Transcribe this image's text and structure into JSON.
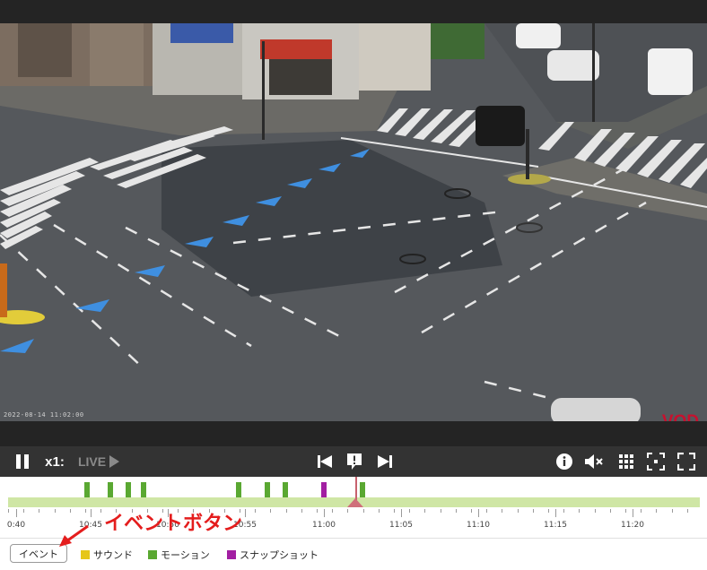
{
  "video": {
    "timestamp": "2022-08-14 11:02:00",
    "badge": "VOD"
  },
  "controls": {
    "speed": "x1:",
    "live": "LIVE",
    "icons": [
      "pause-icon",
      "play-icon",
      "skip-previous-icon",
      "event-mark-icon",
      "skip-next-icon",
      "info-icon",
      "mute-icon",
      "grid-icon",
      "snapshot-frame-icon",
      "fullscreen-icon"
    ]
  },
  "timeline": {
    "labels": [
      "0:40",
      "10:45",
      "10:50",
      "10:55",
      "11:00",
      "11:05",
      "11:10",
      "11:15",
      "11:20"
    ],
    "cursor_time": "11:02",
    "colors": {
      "track": "#cfe6a5",
      "motion": "#5aa832",
      "snapshot": "#a21fa2",
      "cursor": "#cf6f7a"
    },
    "events": [
      {
        "type": "motion",
        "time": "10:44:40"
      },
      {
        "type": "motion",
        "time": "10:46:10"
      },
      {
        "type": "motion",
        "time": "10:47:20"
      },
      {
        "type": "motion",
        "time": "10:48:20"
      },
      {
        "type": "motion",
        "time": "10:54:30"
      },
      {
        "type": "motion",
        "time": "10:56:20"
      },
      {
        "type": "motion",
        "time": "10:57:30"
      },
      {
        "type": "snapshot",
        "time": "11:00:00"
      },
      {
        "type": "motion",
        "time": "11:02:30"
      }
    ]
  },
  "legend": {
    "event_button": "イベント",
    "items": [
      {
        "label": "サウンド",
        "color": "#e6c619"
      },
      {
        "label": "モーション",
        "color": "#5aa832"
      },
      {
        "label": "スナップショット",
        "color": "#a21fa2"
      }
    ]
  },
  "annotation": {
    "text": "イベントボタン",
    "color": "#e41d1d"
  }
}
